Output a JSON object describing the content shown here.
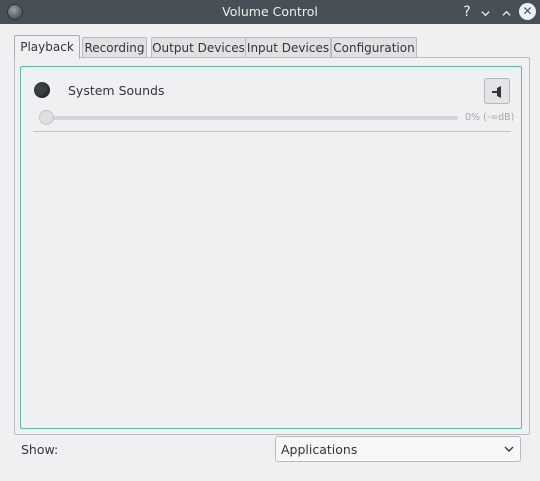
{
  "window": {
    "title": "Volume Control"
  },
  "tabs": [
    {
      "label": "Playback",
      "active": true
    },
    {
      "label": "Recording"
    },
    {
      "label": "Output Devices"
    },
    {
      "label": "Input Devices"
    },
    {
      "label": "Configuration"
    }
  ],
  "streams": [
    {
      "label": "System Sounds",
      "volume_text": "0% (-∞dB)",
      "volume_fraction": 0.0
    }
  ],
  "footer": {
    "show_label": "Show:",
    "filter_value": "Applications"
  },
  "colors": {
    "titlebar": "#475057",
    "accent": "#64b6a8",
    "background": "#eff0f1"
  },
  "icons": [
    "app-icon",
    "help-icon",
    "minimize-icon",
    "maximize-icon",
    "close-icon",
    "mute-toggle-icon",
    "chevron-down-icon"
  ]
}
